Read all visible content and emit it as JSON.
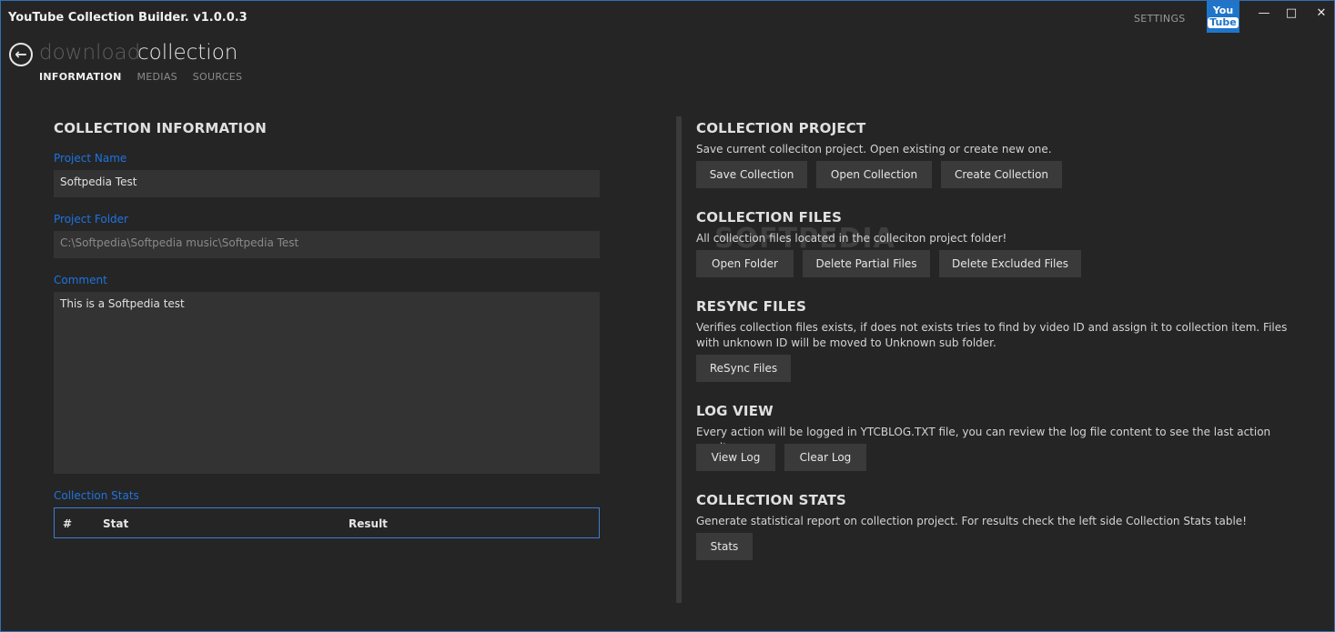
{
  "window": {
    "title": "YouTube Collection Builder. v1.0.0.3",
    "settings_label": "SETTINGS",
    "logo_top": "You",
    "logo_bottom": "Tube",
    "minimize_icon": "—",
    "maximize_icon": "□",
    "close_icon": "✕",
    "border_color": "#2f6fb5"
  },
  "nav": {
    "back_icon": "←",
    "crumb_inactive": "download",
    "crumb_active": "collection",
    "tabs": [
      {
        "label": "INFORMATION",
        "active": true
      },
      {
        "label": "MEDIAS",
        "active": false
      },
      {
        "label": "SOURCES",
        "active": false
      }
    ]
  },
  "info": {
    "heading": "COLLECTION INFORMATION",
    "project_name_label": "Project Name",
    "project_name_value": "Softpedia Test",
    "project_folder_label": "Project Folder",
    "project_folder_value": "C:\\Softpedia\\Softpedia music\\Softpedia Test",
    "comment_label": "Comment",
    "comment_value": "This is a Softpedia test",
    "stats_label": "Collection Stats",
    "stats_columns": [
      "#",
      "Stat",
      "Result"
    ],
    "label_color": "#1e74e0"
  },
  "actions": {
    "project": {
      "heading": "COLLECTION PROJECT",
      "desc": "Save current colleciton project. Open existing or create new one.",
      "buttons": [
        "Save Collection",
        "Open Collection",
        "Create Collection"
      ]
    },
    "files": {
      "heading": "COLLECTION FILES",
      "desc": "All collection files located in the colleciton project folder!",
      "buttons": [
        "Open Folder",
        "Delete Partial Files",
        "Delete Excluded Files"
      ]
    },
    "resync": {
      "heading": "RESYNC FILES",
      "desc": "Verifies collection files exists, if does not exists tries to find by video ID and assign it to collection item. Files with unknown ID will be moved to Unknown sub folder.",
      "buttons": [
        "ReSync Files"
      ]
    },
    "log": {
      "heading": "LOG VIEW",
      "desc": "Every action will be logged in YTCBLOG.TXT file, you can review the log file content to see the last action results.",
      "buttons": [
        "View Log",
        "Clear Log"
      ]
    },
    "stats": {
      "heading": "COLLECTION STATS",
      "desc": "Generate statistical report on collection project. For results check the left side Collection Stats table!",
      "buttons": [
        "Stats"
      ]
    }
  },
  "watermark": "SOFTPEDIA"
}
